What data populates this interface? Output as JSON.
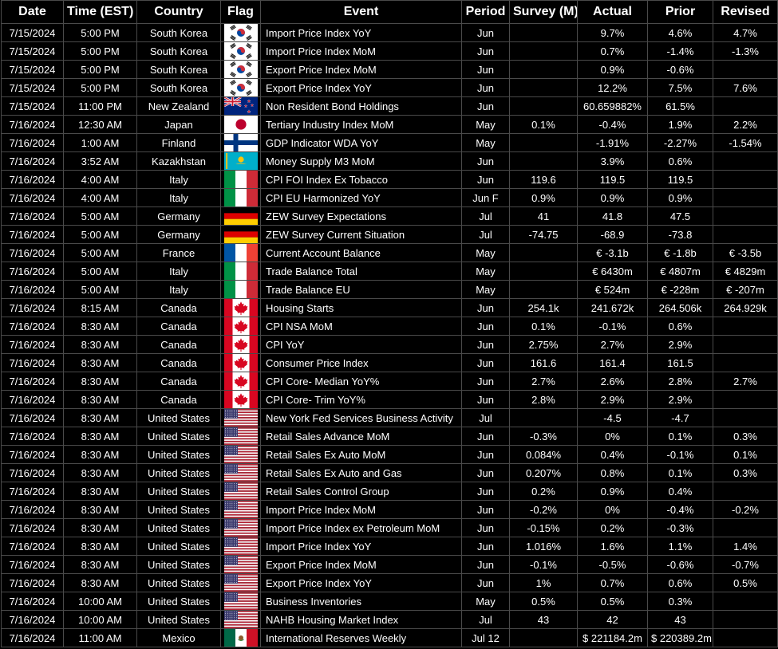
{
  "columns": [
    "Date",
    "Time (EST)",
    "Country",
    "Flag",
    "Event",
    "Period",
    "Survey (M)",
    "Actual",
    "Prior",
    "Revised"
  ],
  "rows": [
    {
      "date": "7/15/2024",
      "time": "5:00 PM",
      "country": "South Korea",
      "flag": "kr-flag-icon",
      "event": "Import Price Index YoY",
      "period": "Jun",
      "survey": "",
      "actual": "9.7%",
      "prior": "4.6%",
      "revised": "4.7%"
    },
    {
      "date": "7/15/2024",
      "time": "5:00 PM",
      "country": "South Korea",
      "flag": "kr-flag-icon",
      "event": "Import Price Index MoM",
      "period": "Jun",
      "survey": "",
      "actual": "0.7%",
      "prior": "-1.4%",
      "revised": "-1.3%"
    },
    {
      "date": "7/15/2024",
      "time": "5:00 PM",
      "country": "South Korea",
      "flag": "kr-flag-icon",
      "event": "Export Price Index MoM",
      "period": "Jun",
      "survey": "",
      "actual": "0.9%",
      "prior": "-0.6%",
      "revised": ""
    },
    {
      "date": "7/15/2024",
      "time": "5:00 PM",
      "country": "South Korea",
      "flag": "kr-flag-icon",
      "event": "Export Price Index YoY",
      "period": "Jun",
      "survey": "",
      "actual": "12.2%",
      "prior": "7.5%",
      "revised": "7.6%"
    },
    {
      "date": "7/15/2024",
      "time": "11:00 PM",
      "country": "New Zealand",
      "flag": "nz-flag-icon",
      "event": "Non Resident Bond Holdings",
      "period": "Jun",
      "survey": "",
      "actual": "60.659882%",
      "prior": "61.5%",
      "revised": ""
    },
    {
      "date": "7/16/2024",
      "time": "12:30 AM",
      "country": "Japan",
      "flag": "jp-flag-icon",
      "event": "Tertiary Industry Index MoM",
      "period": "May",
      "survey": "0.1%",
      "actual": "-0.4%",
      "prior": "1.9%",
      "revised": "2.2%"
    },
    {
      "date": "7/16/2024",
      "time": "1:00 AM",
      "country": "Finland",
      "flag": "fi-flag-icon",
      "event": "GDP Indicator WDA YoY",
      "period": "May",
      "survey": "",
      "actual": "-1.91%",
      "prior": "-2.27%",
      "revised": "-1.54%"
    },
    {
      "date": "7/16/2024",
      "time": "3:52 AM",
      "country": "Kazakhstan",
      "flag": "kz-flag-icon",
      "event": "Money Supply M3 MoM",
      "period": "Jun",
      "survey": "",
      "actual": "3.9%",
      "prior": "0.6%",
      "revised": ""
    },
    {
      "date": "7/16/2024",
      "time": "4:00 AM",
      "country": "Italy",
      "flag": "it-flag-icon",
      "event": "CPI FOI Index Ex Tobacco",
      "period": "Jun",
      "survey": "119.6",
      "actual": "119.5",
      "prior": "119.5",
      "revised": ""
    },
    {
      "date": "7/16/2024",
      "time": "4:00 AM",
      "country": "Italy",
      "flag": "it-flag-icon",
      "event": "CPI EU Harmonized YoY",
      "period": "Jun F",
      "survey": "0.9%",
      "actual": "0.9%",
      "prior": "0.9%",
      "revised": ""
    },
    {
      "date": "7/16/2024",
      "time": "5:00 AM",
      "country": "Germany",
      "flag": "de-flag-icon",
      "event": "ZEW Survey Expectations",
      "period": "Jul",
      "survey": "41",
      "actual": "41.8",
      "prior": "47.5",
      "revised": ""
    },
    {
      "date": "7/16/2024",
      "time": "5:00 AM",
      "country": "Germany",
      "flag": "de-flag-icon",
      "event": "ZEW Survey Current Situation",
      "period": "Jul",
      "survey": "-74.75",
      "actual": "-68.9",
      "prior": "-73.8",
      "revised": ""
    },
    {
      "date": "7/16/2024",
      "time": "5:00 AM",
      "country": "France",
      "flag": "fr-flag-icon",
      "event": "Current Account Balance",
      "period": "May",
      "survey": "",
      "actual": "€ -3.1b",
      "prior": "€ -1.8b",
      "revised": "€ -3.5b"
    },
    {
      "date": "7/16/2024",
      "time": "5:00 AM",
      "country": "Italy",
      "flag": "it-flag-icon",
      "event": "Trade Balance Total",
      "period": "May",
      "survey": "",
      "actual": "€ 6430m",
      "prior": "€ 4807m",
      "revised": "€ 4829m"
    },
    {
      "date": "7/16/2024",
      "time": "5:00 AM",
      "country": "Italy",
      "flag": "it-flag-icon",
      "event": "Trade Balance EU",
      "period": "May",
      "survey": "",
      "actual": "€ 524m",
      "prior": "€ -228m",
      "revised": "€ -207m"
    },
    {
      "date": "7/16/2024",
      "time": "8:15 AM",
      "country": "Canada",
      "flag": "ca-flag-icon",
      "event": "Housing Starts",
      "period": "Jun",
      "survey": "254.1k",
      "actual": "241.672k",
      "prior": "264.506k",
      "revised": "264.929k"
    },
    {
      "date": "7/16/2024",
      "time": "8:30 AM",
      "country": "Canada",
      "flag": "ca-flag-icon",
      "event": "CPI NSA MoM",
      "period": "Jun",
      "survey": "0.1%",
      "actual": "-0.1%",
      "prior": "0.6%",
      "revised": ""
    },
    {
      "date": "7/16/2024",
      "time": "8:30 AM",
      "country": "Canada",
      "flag": "ca-flag-icon",
      "event": "CPI YoY",
      "period": "Jun",
      "survey": "2.75%",
      "actual": "2.7%",
      "prior": "2.9%",
      "revised": ""
    },
    {
      "date": "7/16/2024",
      "time": "8:30 AM",
      "country": "Canada",
      "flag": "ca-flag-icon",
      "event": "Consumer Price Index",
      "period": "Jun",
      "survey": "161.6",
      "actual": "161.4",
      "prior": "161.5",
      "revised": ""
    },
    {
      "date": "7/16/2024",
      "time": "8:30 AM",
      "country": "Canada",
      "flag": "ca-flag-icon",
      "event": "CPI Core- Median YoY%",
      "period": "Jun",
      "survey": "2.7%",
      "actual": "2.6%",
      "prior": "2.8%",
      "revised": "2.7%"
    },
    {
      "date": "7/16/2024",
      "time": "8:30 AM",
      "country": "Canada",
      "flag": "ca-flag-icon",
      "event": "CPI Core- Trim YoY%",
      "period": "Jun",
      "survey": "2.8%",
      "actual": "2.9%",
      "prior": "2.9%",
      "revised": ""
    },
    {
      "date": "7/16/2024",
      "time": "8:30 AM",
      "country": "United States",
      "flag": "us-flag-icon",
      "event": "New York Fed Services Business Activity",
      "period": "Jul",
      "survey": "",
      "actual": "-4.5",
      "prior": "-4.7",
      "revised": ""
    },
    {
      "date": "7/16/2024",
      "time": "8:30 AM",
      "country": "United States",
      "flag": "us-flag-icon",
      "event": "Retail Sales Advance MoM",
      "period": "Jun",
      "survey": "-0.3%",
      "actual": "0%",
      "prior": "0.1%",
      "revised": "0.3%"
    },
    {
      "date": "7/16/2024",
      "time": "8:30 AM",
      "country": "United States",
      "flag": "us-flag-icon",
      "event": "Retail Sales Ex Auto MoM",
      "period": "Jun",
      "survey": "0.084%",
      "actual": "0.4%",
      "prior": "-0.1%",
      "revised": "0.1%"
    },
    {
      "date": "7/16/2024",
      "time": "8:30 AM",
      "country": "United States",
      "flag": "us-flag-icon",
      "event": "Retail Sales Ex Auto and Gas",
      "period": "Jun",
      "survey": "0.207%",
      "actual": "0.8%",
      "prior": "0.1%",
      "revised": "0.3%"
    },
    {
      "date": "7/16/2024",
      "time": "8:30 AM",
      "country": "United States",
      "flag": "us-flag-icon",
      "event": "Retail Sales Control Group",
      "period": "Jun",
      "survey": "0.2%",
      "actual": "0.9%",
      "prior": "0.4%",
      "revised": ""
    },
    {
      "date": "7/16/2024",
      "time": "8:30 AM",
      "country": "United States",
      "flag": "us-flag-icon",
      "event": "Import Price Index MoM",
      "period": "Jun",
      "survey": "-0.2%",
      "actual": "0%",
      "prior": "-0.4%",
      "revised": "-0.2%"
    },
    {
      "date": "7/16/2024",
      "time": "8:30 AM",
      "country": "United States",
      "flag": "us-flag-icon",
      "event": "Import Price Index ex Petroleum MoM",
      "period": "Jun",
      "survey": "-0.15%",
      "actual": "0.2%",
      "prior": "-0.3%",
      "revised": ""
    },
    {
      "date": "7/16/2024",
      "time": "8:30 AM",
      "country": "United States",
      "flag": "us-flag-icon",
      "event": "Import Price Index YoY",
      "period": "Jun",
      "survey": "1.016%",
      "actual": "1.6%",
      "prior": "1.1%",
      "revised": "1.4%"
    },
    {
      "date": "7/16/2024",
      "time": "8:30 AM",
      "country": "United States",
      "flag": "us-flag-icon",
      "event": "Export Price Index MoM",
      "period": "Jun",
      "survey": "-0.1%",
      "actual": "-0.5%",
      "prior": "-0.6%",
      "revised": "-0.7%"
    },
    {
      "date": "7/16/2024",
      "time": "8:30 AM",
      "country": "United States",
      "flag": "us-flag-icon",
      "event": "Export Price Index YoY",
      "period": "Jun",
      "survey": "1%",
      "actual": "0.7%",
      "prior": "0.6%",
      "revised": "0.5%"
    },
    {
      "date": "7/16/2024",
      "time": "10:00 AM",
      "country": "United States",
      "flag": "us-flag-icon",
      "event": "Business Inventories",
      "period": "May",
      "survey": "0.5%",
      "actual": "0.5%",
      "prior": "0.3%",
      "revised": ""
    },
    {
      "date": "7/16/2024",
      "time": "10:00 AM",
      "country": "United States",
      "flag": "us-flag-icon",
      "event": "NAHB Housing Market Index",
      "period": "Jul",
      "survey": "43",
      "actual": "42",
      "prior": "43",
      "revised": ""
    },
    {
      "date": "7/16/2024",
      "time": "11:00 AM",
      "country": "Mexico",
      "flag": "mx-flag-icon",
      "event": "International Reserves Weekly",
      "period": "Jul 12",
      "survey": "",
      "actual": "$ 221184.2m",
      "prior": "$ 220389.2m",
      "revised": ""
    }
  ],
  "colors": {
    "background": "#000000",
    "text": "#ffffff",
    "grid": "#4a4a4a"
  }
}
